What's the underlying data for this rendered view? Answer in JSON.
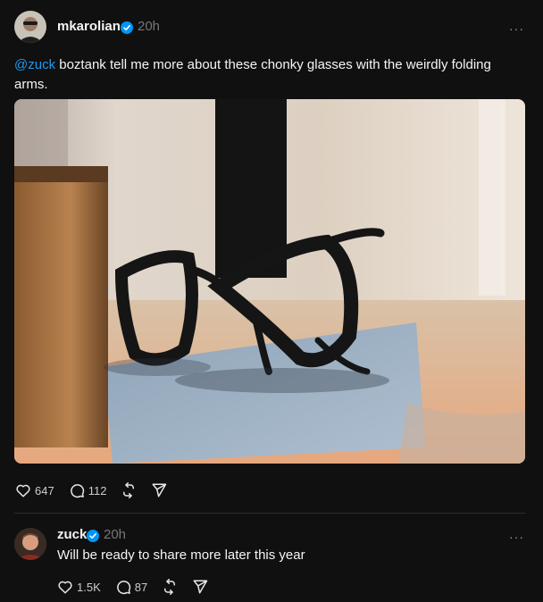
{
  "post": {
    "username": "mkarolian",
    "time": "20h",
    "more": "···",
    "mention": "@zuck",
    "text": " boztank tell me more about these chonky glasses with the weirdly folding arms.",
    "likes": "647",
    "replies": "112"
  },
  "reply": {
    "username": "zuck",
    "time": "20h",
    "more": "···",
    "text": "Will be ready to share more later this year",
    "likes": "1.5K",
    "replies": "87"
  },
  "colors": {
    "background": "#101010",
    "mention": "#1d9bf0",
    "verified": "#0095f6"
  },
  "icons": [
    "heart-icon",
    "comment-icon",
    "repost-icon",
    "share-icon",
    "verified-badge-icon"
  ]
}
